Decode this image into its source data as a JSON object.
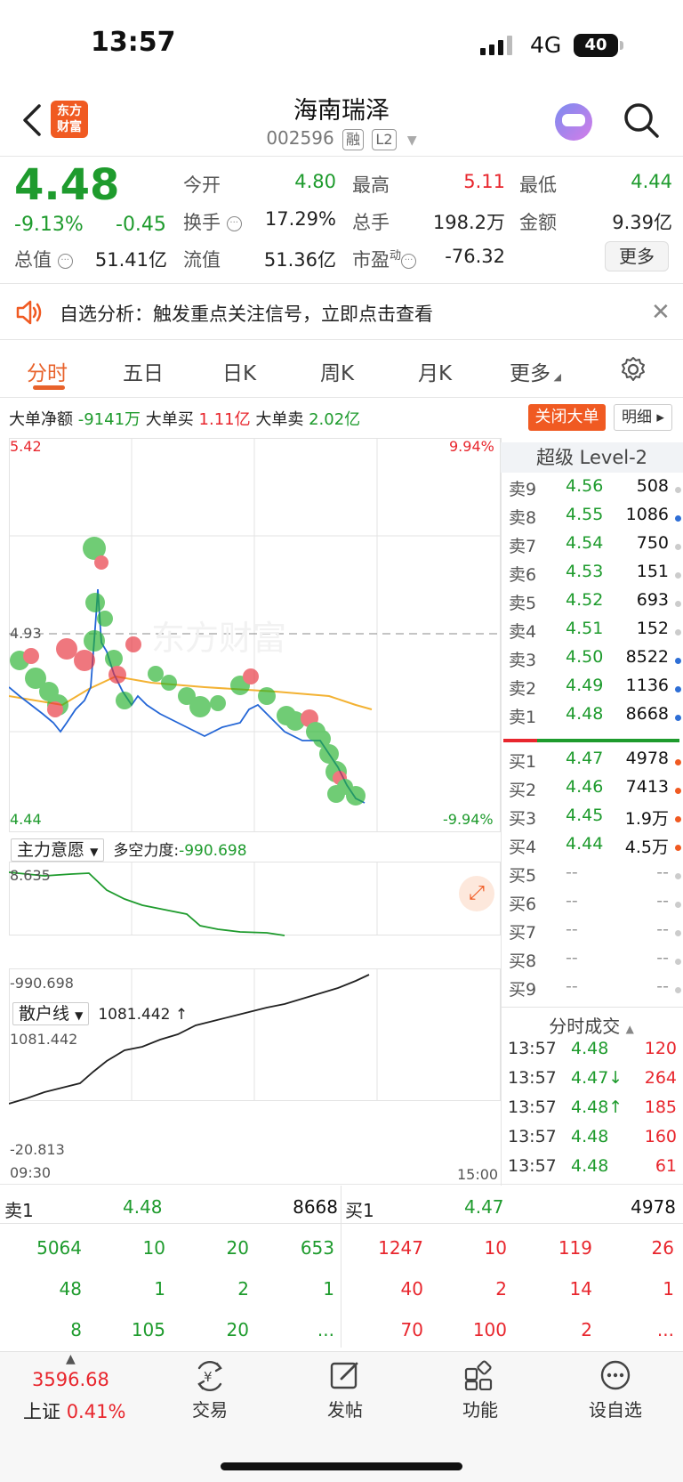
{
  "status_bar": {
    "time": "13:57",
    "network": "4G",
    "battery": "40"
  },
  "header": {
    "logo_line1": "东方",
    "logo_line2": "财富",
    "stock_name": "海南瑞泽",
    "stock_code": "002596",
    "tag_margin": "融",
    "tag_level": "L2"
  },
  "quote": {
    "price": "4.48",
    "change_pct": "-9.13%",
    "change_abs": "-0.45",
    "open_label": "今开",
    "open": "4.80",
    "high_label": "最高",
    "high": "5.11",
    "low_label": "最低",
    "low": "4.44",
    "turnover_label": "换手",
    "turnover": "17.29%",
    "volume_label": "总手",
    "volume": "198.2万",
    "amount_label": "金额",
    "amount": "9.39亿",
    "mktcap_label": "总值",
    "mktcap": "51.41亿",
    "float_label": "流值",
    "float": "51.36亿",
    "pe_label": "市盈",
    "pe_sup": "动",
    "pe": "-76.32",
    "more_label": "更多"
  },
  "alert": {
    "text": "自选分析：触发重点关注信号，立即点击查看"
  },
  "tabs": [
    "分时",
    "五日",
    "日K",
    "周K",
    "月K",
    "更多"
  ],
  "big_order": {
    "net_label": "大单净额",
    "net": "-9141万",
    "buy_label": "大单买",
    "buy": "1.11亿",
    "sell_label": "大单卖",
    "sell": "2.02亿",
    "close_btn": "关闭大单",
    "detail_btn": "明细"
  },
  "intraday": {
    "y_top": "5.42",
    "y_mid": "4.93",
    "y_bottom": "4.44",
    "pct_top": "9.94%",
    "pct_bottom": "-9.94%",
    "watermark": "东方财富",
    "t_start": "09:30",
    "t_end": "15:00"
  },
  "indicator1": {
    "name": "主力意愿",
    "metric_label": "多空力度:",
    "metric": "-990.698",
    "y_top": "8.635",
    "y_bottom": "-990.698"
  },
  "indicator2": {
    "name": "散户线",
    "metric": "1081.442 ↑",
    "y_top": "1081.442",
    "y_bottom": "-20.813"
  },
  "level2": {
    "title": "超级 Level-2",
    "asks": [
      {
        "label": "卖9",
        "price": "4.56",
        "vol": "508",
        "dot": "#cccccc"
      },
      {
        "label": "卖8",
        "price": "4.55",
        "vol": "1086",
        "dot": "#2f6fd6"
      },
      {
        "label": "卖7",
        "price": "4.54",
        "vol": "750",
        "dot": "#cccccc"
      },
      {
        "label": "卖6",
        "price": "4.53",
        "vol": "151",
        "dot": "#cccccc"
      },
      {
        "label": "卖5",
        "price": "4.52",
        "vol": "693",
        "dot": "#cccccc"
      },
      {
        "label": "卖4",
        "price": "4.51",
        "vol": "152",
        "dot": "#cccccc"
      },
      {
        "label": "卖3",
        "price": "4.50",
        "vol": "8522",
        "dot": "#2f6fd6"
      },
      {
        "label": "卖2",
        "price": "4.49",
        "vol": "1136",
        "dot": "#2f6fd6"
      },
      {
        "label": "卖1",
        "price": "4.48",
        "vol": "8668",
        "dot": "#2f6fd6"
      }
    ],
    "bids": [
      {
        "label": "买1",
        "price": "4.47",
        "vol": "4978",
        "dot": "#f05a22"
      },
      {
        "label": "买2",
        "price": "4.46",
        "vol": "7413",
        "dot": "#f05a22"
      },
      {
        "label": "买3",
        "price": "4.45",
        "vol": "1.9万",
        "dot": "#f05a22"
      },
      {
        "label": "买4",
        "price": "4.44",
        "vol": "4.5万",
        "dot": "#f05a22"
      },
      {
        "label": "买5",
        "price": "--",
        "vol": "--",
        "dot": "#cccccc"
      },
      {
        "label": "买6",
        "price": "--",
        "vol": "--",
        "dot": "#cccccc"
      },
      {
        "label": "买7",
        "price": "--",
        "vol": "--",
        "dot": "#cccccc"
      },
      {
        "label": "买8",
        "price": "--",
        "vol": "--",
        "dot": "#cccccc"
      },
      {
        "label": "买9",
        "price": "--",
        "vol": "--",
        "dot": "#cccccc"
      }
    ]
  },
  "trades": {
    "title": "分时成交",
    "rows": [
      {
        "time": "13:57",
        "price": "4.48",
        "vol": "120"
      },
      {
        "time": "13:57",
        "price": "4.47↓",
        "vol": "264"
      },
      {
        "time": "13:57",
        "price": "4.48↑",
        "vol": "185"
      },
      {
        "time": "13:57",
        "price": "4.48",
        "vol": "160"
      },
      {
        "time": "13:57",
        "price": "4.48",
        "vol": "61"
      }
    ]
  },
  "depth_detail": {
    "sell_label": "卖1",
    "sell_price": "4.48",
    "sell_vol": "8668",
    "buy_label": "买1",
    "buy_price": "4.47",
    "buy_vol": "4978",
    "sell_grid": [
      [
        "5064",
        "10",
        "20",
        "653"
      ],
      [
        "48",
        "1",
        "2",
        "1"
      ],
      [
        "8",
        "105",
        "20",
        "..."
      ]
    ],
    "buy_grid": [
      [
        "1247",
        "10",
        "119",
        "26"
      ],
      [
        "40",
        "2",
        "14",
        "1"
      ],
      [
        "70",
        "100",
        "2",
        "..."
      ]
    ]
  },
  "bottom_nav": {
    "index_value": "3596.68",
    "index_name": "上证",
    "index_change": "0.41%",
    "items": [
      "交易",
      "发帖",
      "功能",
      "设自选"
    ]
  }
}
